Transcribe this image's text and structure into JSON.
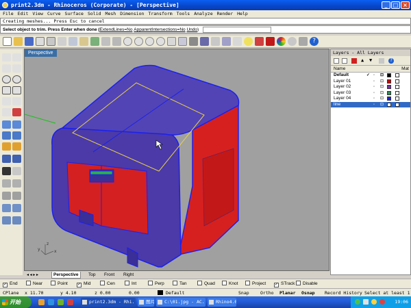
{
  "window": {
    "title": "print2.3dm - Rhinoceros (Corporate) - [Perspective]"
  },
  "menu": [
    "File",
    "Edit",
    "View",
    "Curve",
    "Surface",
    "Solid",
    "Mesh",
    "Dimension",
    "Transform",
    "Tools",
    "Analyze",
    "Render",
    "Help"
  ],
  "command": {
    "history": "Creating meshes... Press Esc to cancel",
    "prompt": "Select object to trim. Press Enter when done (",
    "opt1": "ExtendLines=No",
    "opt2": "ApparentIntersections=No",
    "opt3": "Undo",
    "close": ")"
  },
  "viewport": {
    "title": "Perspective",
    "axis_x": "x",
    "axis_y": "y",
    "axis_z": "z"
  },
  "viewport_tabs": [
    "Perspective",
    "Top",
    "Front",
    "Right"
  ],
  "layers": {
    "title": "Layers - All Layers",
    "col_name": "Name",
    "col_mat": "Mat",
    "rows": [
      {
        "name": "Default",
        "color": "#000000",
        "state": "current"
      },
      {
        "name": "Layer 01",
        "color": "#cc0000",
        "state": ""
      },
      {
        "name": "Layer 02",
        "color": "#7a2fa0",
        "state": ""
      },
      {
        "name": "Layer 03",
        "color": "#2e8b57",
        "state": ""
      },
      {
        "name": "Layer 04",
        "color": "#1c1ce0",
        "state": ""
      },
      {
        "name": "line",
        "color": "#ffffff",
        "state": "selected"
      }
    ]
  },
  "osnap": [
    {
      "label": "End",
      "checked": true
    },
    {
      "label": "Near",
      "checked": false
    },
    {
      "label": "Point",
      "checked": false
    },
    {
      "label": "Mid",
      "checked": true
    },
    {
      "label": "Cen",
      "checked": false
    },
    {
      "label": "Int",
      "checked": false
    },
    {
      "label": "Perp",
      "checked": false
    },
    {
      "label": "Tan",
      "checked": false
    },
    {
      "label": "Quad",
      "checked": false
    },
    {
      "label": "Knot",
      "checked": false
    },
    {
      "label": "Project",
      "checked": false
    },
    {
      "label": "STrack",
      "checked": true
    },
    {
      "label": "Disable",
      "checked": false
    }
  ],
  "status": {
    "plane": "CPlane",
    "x": "x 11.70",
    "y": "y 4.10",
    "z": "z 0.00",
    "z2": "0.00",
    "layer": "Default",
    "snap": "Snap",
    "ortho": "Ortho",
    "planar": "Planar",
    "osnap": "Osnap",
    "record": "Record History",
    "select": "Select at least 1"
  },
  "taskbar": {
    "start": "开始",
    "tasks": [
      "print2.3dm - Rhi...",
      "图片-00...",
      "C:\\01.jpg - AC...",
      "Rhino4.0..."
    ],
    "clock": "19:06"
  },
  "colors": {
    "model_body": "#4b3aa8",
    "model_edge": "#1a20f0",
    "panel_red": "#d81818",
    "viewport_bg": "#a0a0a0",
    "active_title": "#3a6ea5"
  }
}
